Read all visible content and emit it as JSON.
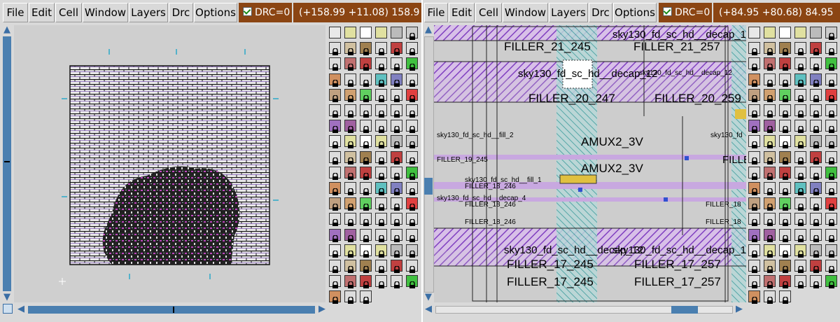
{
  "menu": {
    "file": "File",
    "edit": "Edit",
    "cell": "Cell",
    "window": "Window",
    "layers": "Layers",
    "drc": "Drc",
    "options": "Options"
  },
  "window1": {
    "drc_status": "DRC=0",
    "coordinates": "(+158.99 +11.08) 158.9"
  },
  "window2": {
    "drc_status": "DRC=0",
    "coordinates": "(+84.95 +80.68) 84.95",
    "cell_labels": [
      "FILLER_21_245",
      "sky130_fd_sc_hd__decap_12",
      "FILLER_21_257",
      "sky130_fd_sc_hd__decap_12",
      "sky130_fd_sc_hd__decap_12",
      "FILLER_20_247",
      "FILLER_20_259",
      "AMUX2_3V",
      "AMUX2_3V",
      "sky130_fd_sc_hd__fill_2",
      "FILLER_19_245",
      "sky130_fd_sc_hd__fill_1",
      "FILLER_18_246",
      "sky130_fd_sc_hd__decap_4",
      "FILLER_18_246",
      "FILLER_18",
      "FILLER_18_246",
      "FILLER_18",
      "sky130_fd_sc_hd__decap_12",
      "sky130_fd_sc_hd__decap_12",
      "FILLER_17_245",
      "FILLER_17_257",
      "FILLER_17_245",
      "FILLER_17_257",
      "FILLE",
      "sky130_fd"
    ]
  },
  "palette": {
    "colors": {
      "accent_brown": "#8b4513",
      "scroll_blue": "#4a7fb0",
      "layout_purple": "#8040c0",
      "layout_teal": "#40a0a0",
      "layout_magenta": "#c040c0"
    }
  }
}
